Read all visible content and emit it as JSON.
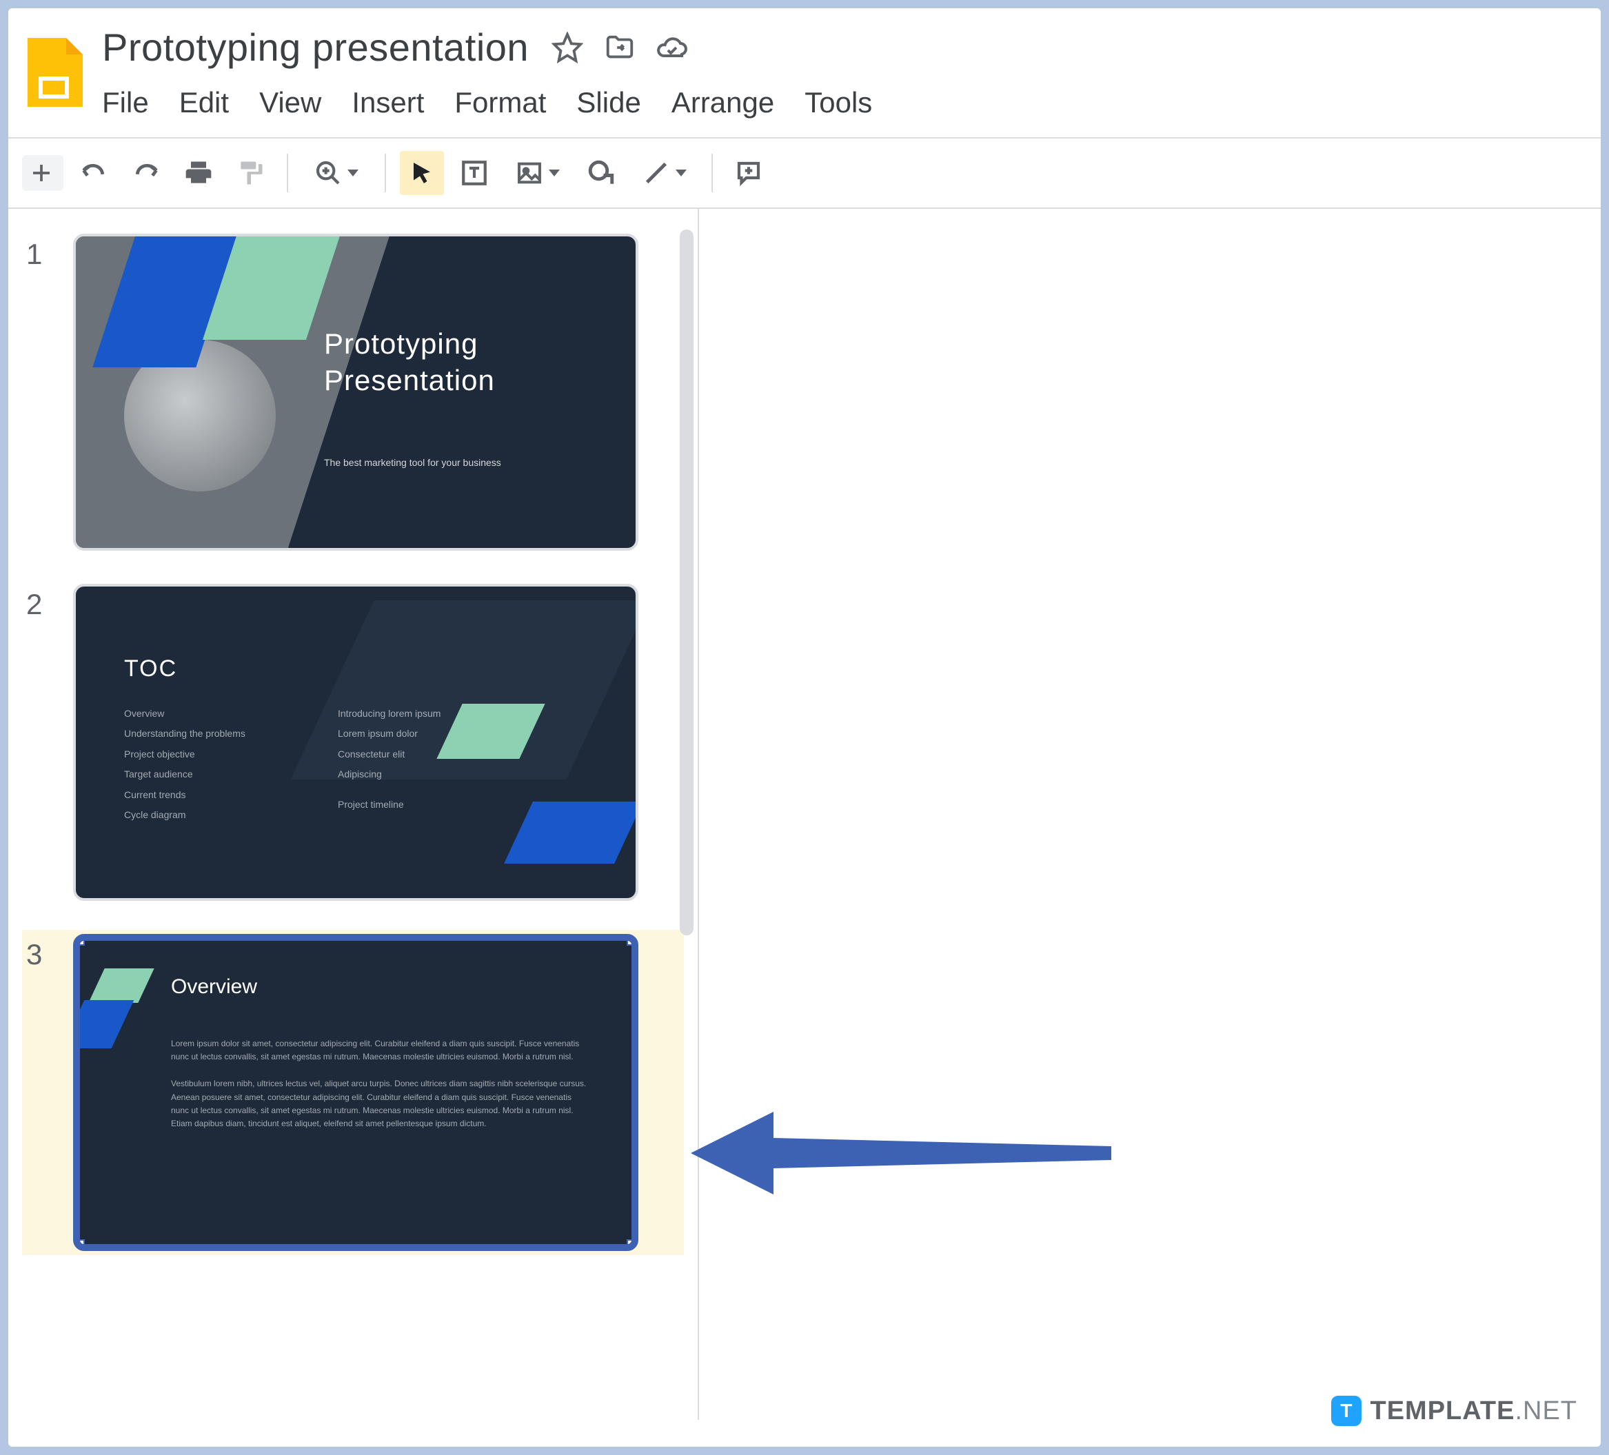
{
  "doc": {
    "title": "Prototyping presentation"
  },
  "menu": {
    "file": "File",
    "edit": "Edit",
    "view": "View",
    "insert": "Insert",
    "format": "Format",
    "slide": "Slide",
    "arrange": "Arrange",
    "tools": "Tools"
  },
  "slides": [
    {
      "number": "1",
      "title": "Prototyping\nPresentation",
      "subtitle": "The best marketing tool for your business"
    },
    {
      "number": "2",
      "title": "TOC",
      "col1": [
        "Overview",
        "Understanding the problems",
        "Project objective",
        "Target audience",
        "Current trends",
        "Cycle diagram"
      ],
      "col2_heading": "Introducing lorem ipsum",
      "col2": [
        "Lorem ipsum dolor",
        "Consectetur elit",
        "Adipiscing",
        "Project timeline"
      ]
    },
    {
      "number": "3",
      "title": "Overview",
      "p1": "Lorem ipsum dolor sit amet, consectetur adipiscing elit. Curabitur eleifend a diam quis suscipit. Fusce venenatis nunc ut lectus convallis, sit amet egestas mi rutrum. Maecenas molestie ultricies euismod. Morbi a rutrum nisl.",
      "p2": "Vestibulum lorem nibh, ultrices lectus vel, aliquet arcu turpis. Donec ultrices diam sagittis nibh scelerisque cursus. Aenean posuere sit amet, consectetur adipiscing elit. Curabitur eleifend a diam quis suscipit. Fusce venenatis nunc ut lectus convallis, sit amet egestas mi rutrum. Maecenas molestie ultricies euismod. Morbi a rutrum nisl. Etiam dapibus diam, tincidunt est aliquet, eleifend sit amet pellentesque ipsum dictum.",
      "selected": true
    }
  ],
  "watermark": {
    "brand": "TEMPLATE",
    "suffix": ".NET"
  }
}
